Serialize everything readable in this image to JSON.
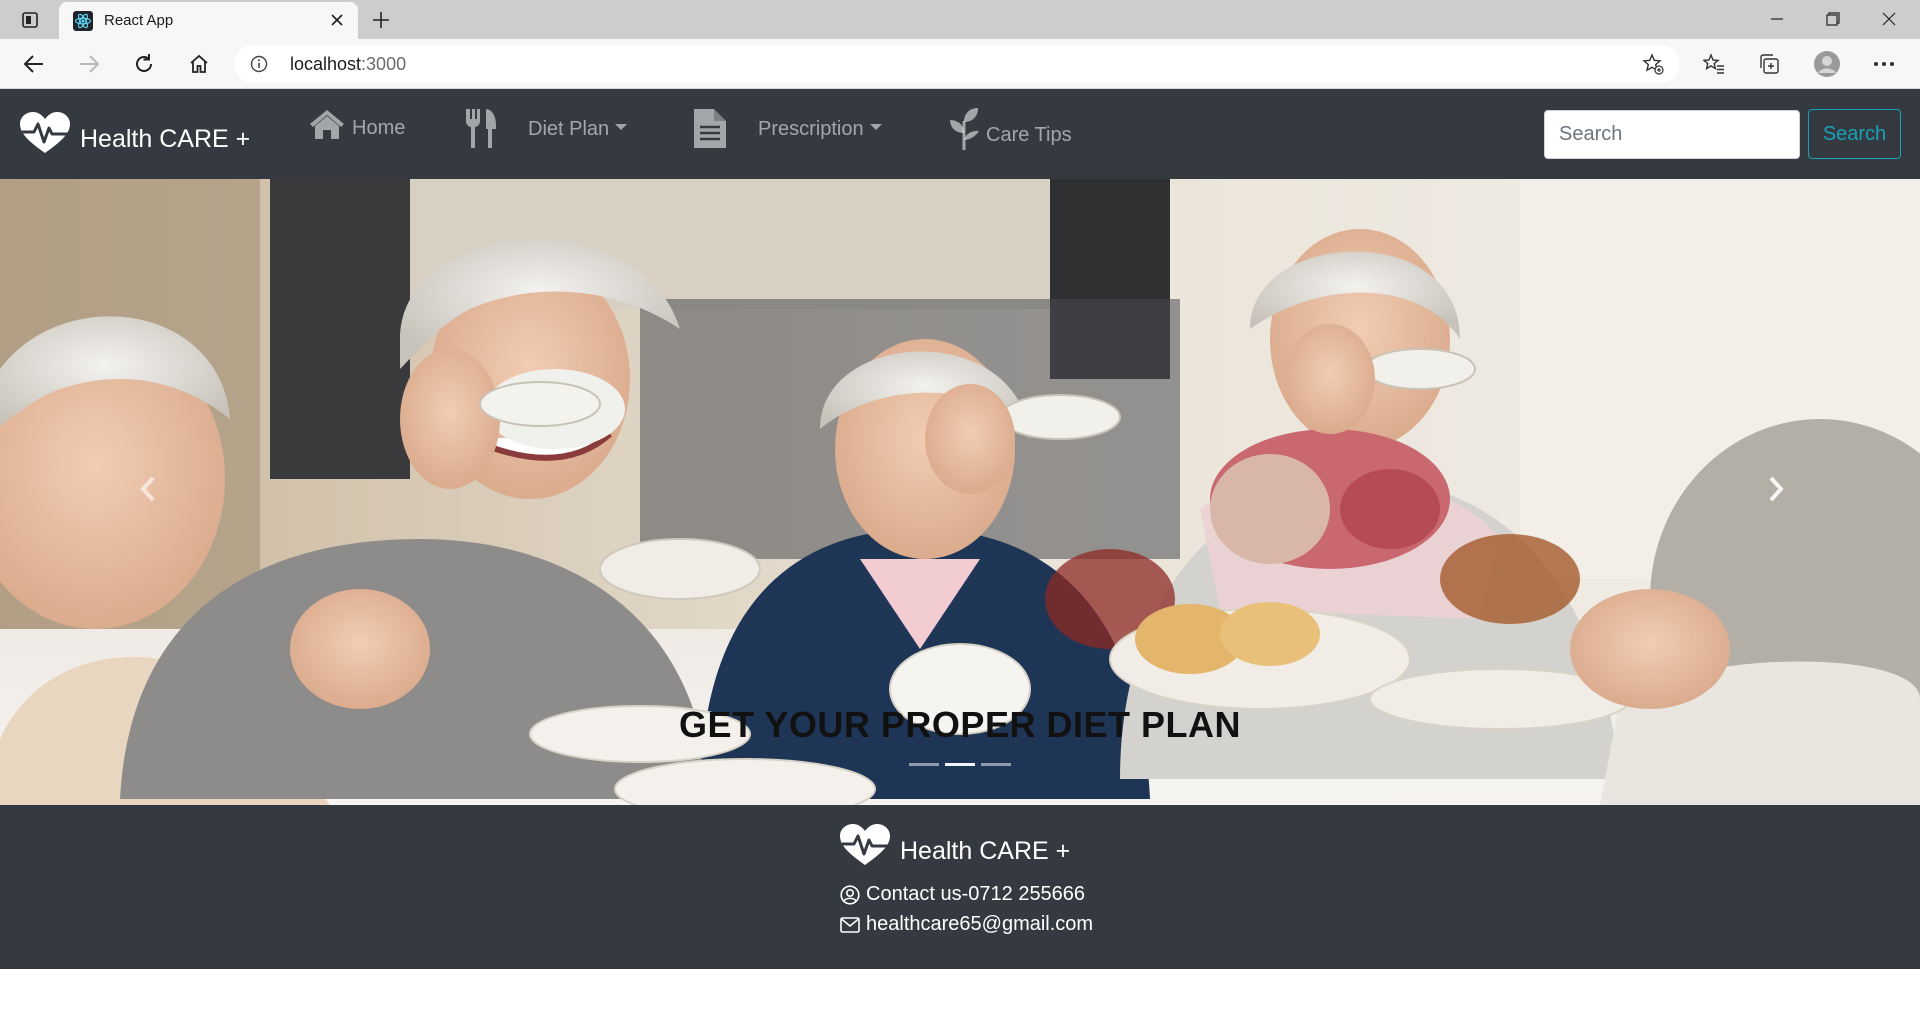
{
  "browser": {
    "tab_title": "React App",
    "url_host": "localhost",
    "url_port": ":3000"
  },
  "navbar": {
    "brand": "Health CARE +",
    "items": [
      {
        "label": "Home",
        "icon": "home-icon"
      },
      {
        "label": "Diet Plan",
        "icon": "utensils-icon",
        "dropdown": true
      },
      {
        "label": "Prescription",
        "icon": "file-icon",
        "dropdown": true
      },
      {
        "label": "Care Tips",
        "icon": "seedling-icon"
      }
    ],
    "search_placeholder": "Search",
    "search_button": "Search"
  },
  "hero": {
    "caption": "GET YOUR PROPER DIET PLAN"
  },
  "footer": {
    "brand": "Health CARE +",
    "contact": "Contact us-0712 255666",
    "email": "healthcare65@gmail.com"
  },
  "colors": {
    "navbar_bg": "#343a40",
    "search_accent": "#17a2b8"
  }
}
